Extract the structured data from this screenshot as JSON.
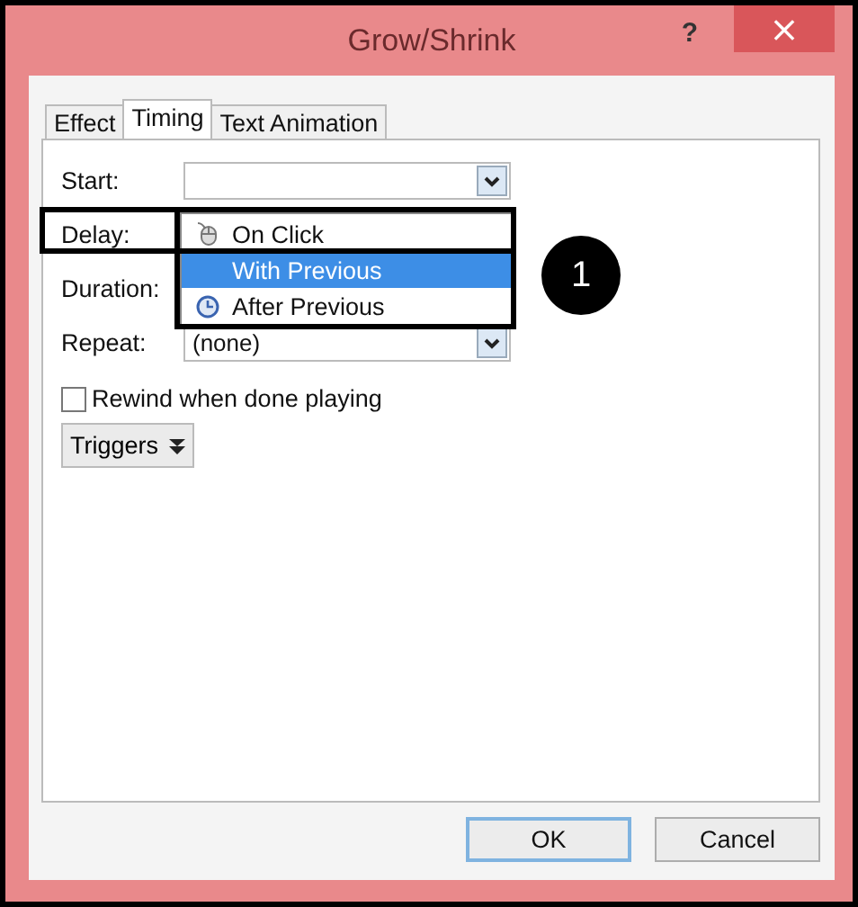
{
  "window": {
    "title": "Grow/Shrink",
    "help": "?",
    "close": "×"
  },
  "tabs": [
    {
      "label": "Effect",
      "selected": false
    },
    {
      "label": "Timing",
      "selected": true
    },
    {
      "label": "Text Animation",
      "selected": false
    }
  ],
  "form": {
    "start": {
      "label": "Start:"
    },
    "delay": {
      "label": "Delay:"
    },
    "duration": {
      "label": "Duration:"
    },
    "repeat": {
      "label": "Repeat:",
      "value": "(none)"
    }
  },
  "dropdown": {
    "items": [
      {
        "label": "On Click",
        "kind": "mouse",
        "selected": false
      },
      {
        "label": "With Previous",
        "kind": "none",
        "selected": true
      },
      {
        "label": "After Previous",
        "kind": "clock",
        "selected": false
      }
    ]
  },
  "rewind": {
    "label": "Rewind when done playing",
    "checked": false
  },
  "triggers": {
    "label": "Triggers"
  },
  "callout": {
    "number": "1"
  },
  "buttons": [
    {
      "label": "OK",
      "default": true
    },
    {
      "label": "Cancel",
      "default": false
    }
  ]
}
